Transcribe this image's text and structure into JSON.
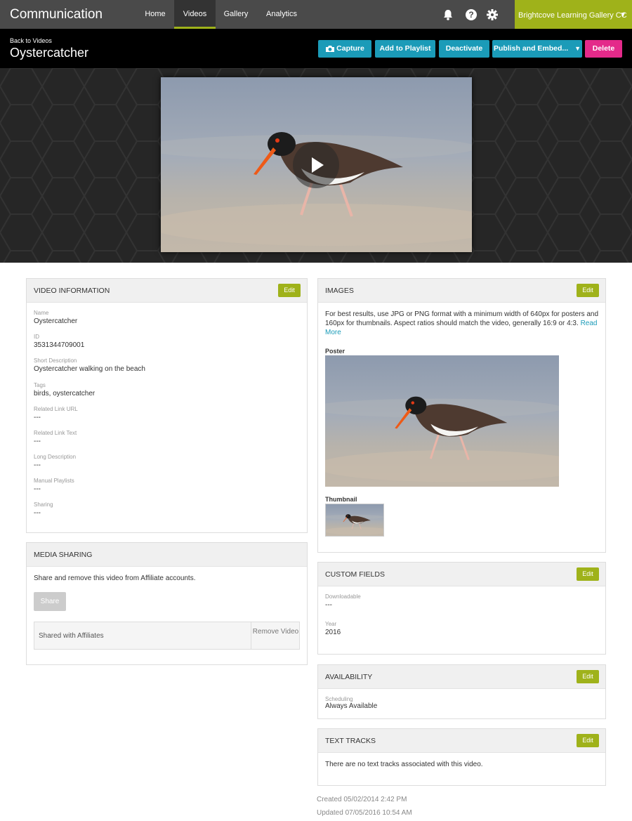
{
  "app": {
    "title": "Communication",
    "account": "Brightcove Learning Gallery CC"
  },
  "nav": {
    "tabs": [
      "Home",
      "Videos",
      "Gallery",
      "Analytics"
    ],
    "active": "Videos"
  },
  "icons": {
    "notifications": "bell-icon",
    "help": "question-icon",
    "settings": "gear-icon",
    "capture": "camera-icon",
    "play": "play-icon"
  },
  "header": {
    "back_label": "Back to Videos",
    "title": "Oystercatcher",
    "buttons": {
      "capture": "Capture",
      "add_playlist": "Add to Playlist",
      "deactivate": "Deactivate",
      "publish": "Publish and Embed...",
      "delete": "Delete"
    }
  },
  "video_info": {
    "heading": "VIDEO INFORMATION",
    "edit": "Edit",
    "fields": [
      {
        "label": "Name",
        "value": "Oystercatcher"
      },
      {
        "label": "ID",
        "value": "3531344709001"
      },
      {
        "label": "Short Description",
        "value": "Oystercatcher walking on the beach"
      },
      {
        "label": "Tags",
        "value": "birds, oystercatcher"
      },
      {
        "label": "Related Link URL",
        "value": "---"
      },
      {
        "label": "Related Link Text",
        "value": "---"
      },
      {
        "label": "Long Description",
        "value": "---"
      },
      {
        "label": "Manual Playlists",
        "value": "---"
      },
      {
        "label": "Sharing",
        "value": "---"
      }
    ]
  },
  "media_sharing": {
    "heading": "MEDIA SHARING",
    "description": "Share and remove this video from Affiliate accounts.",
    "share_button": "Share",
    "table_col1": "Shared with Affiliates",
    "table_col2": "Remove Video"
  },
  "images": {
    "heading": "IMAGES",
    "edit": "Edit",
    "help_text": "For best results, use JPG or PNG format with a minimum width of 640px for posters and 160px for thumbnails. Aspect ratios should match the video, generally 16:9 or 4:3.",
    "read_more": "Read More",
    "poster_label": "Poster",
    "thumbnail_label": "Thumbnail"
  },
  "custom_fields": {
    "heading": "CUSTOM FIELDS",
    "edit": "Edit",
    "fields": [
      {
        "label": "Downloadable",
        "value": "---"
      },
      {
        "label": "Year",
        "value": "2016"
      }
    ]
  },
  "availability": {
    "heading": "AVAILABILITY",
    "edit": "Edit",
    "label": "Scheduling",
    "value": "Always Available"
  },
  "text_tracks": {
    "heading": "TEXT TRACKS",
    "edit": "Edit",
    "message": "There are no text tracks associated with this video."
  },
  "meta": {
    "created": "Created 05/02/2014 2:42 PM",
    "updated": "Updated 07/05/2016 10:54 AM"
  },
  "colors": {
    "accent_green": "#9fb21a",
    "button_blue": "#1b9bb8",
    "delete_pink": "#e42a8a"
  }
}
